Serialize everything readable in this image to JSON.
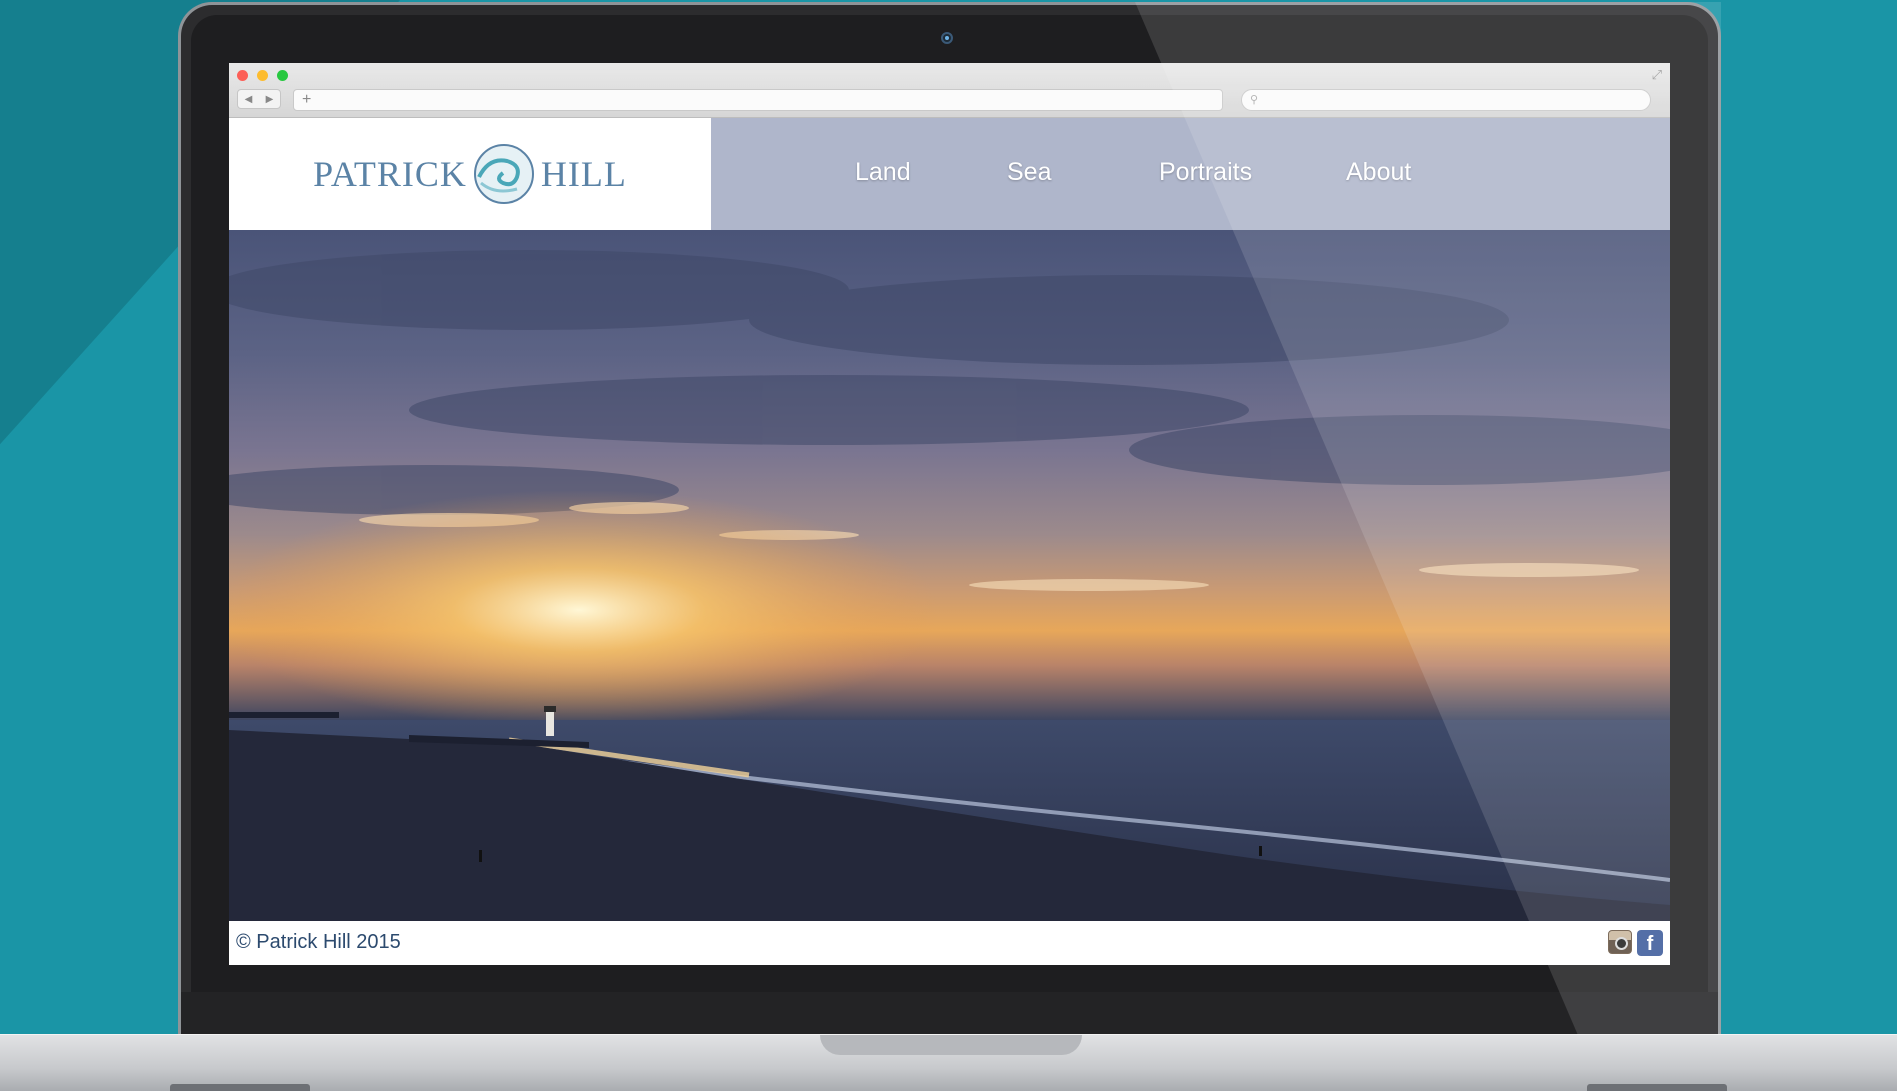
{
  "site": {
    "logo": {
      "left_word": "PATRICK",
      "right_word": "HILL"
    },
    "nav": [
      {
        "label": "Land"
      },
      {
        "label": "Sea"
      },
      {
        "label": "Portraits"
      },
      {
        "label": "About"
      }
    ],
    "footer": {
      "copyright": "© Patrick Hill 2015",
      "social": [
        "instagram-icon",
        "facebook-icon"
      ],
      "facebook_glyph": "f"
    },
    "hero": {
      "subject": "sunset beach with lighthouse"
    }
  },
  "browser": {
    "newtab_glyph": "+",
    "back_glyph": "◀",
    "forward_glyph": "▶"
  },
  "colors": {
    "background": "#1a95a6",
    "logo": "#5b83a6",
    "nav_bar": "#6e7aa0",
    "footer_text": "#2c4a6e",
    "facebook": "#3b5a9a"
  }
}
